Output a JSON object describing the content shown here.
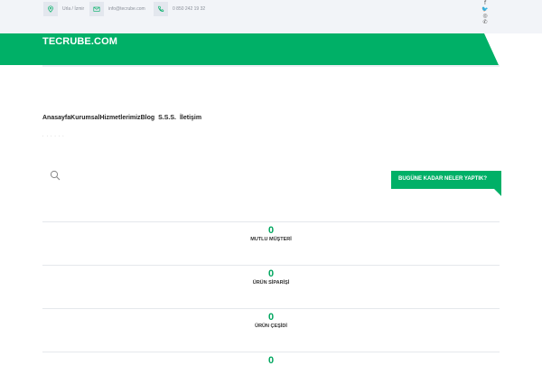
{
  "topbar": {
    "location": "Urla / İzmir",
    "email": "info@tecrube.com",
    "phone": "0 850 242 19 32",
    "social": [
      {
        "icon": "facebook-icon",
        "glyph": "f"
      },
      {
        "icon": "twitter-icon",
        "glyph": "🐦"
      },
      {
        "icon": "instagram-icon",
        "glyph": "◎"
      },
      {
        "icon": "whatsapp-icon",
        "glyph": "✆"
      }
    ]
  },
  "header": {
    "brand": "TECRUBE.COM"
  },
  "nav": {
    "items": [
      "Anasayfa",
      "Kurumsal",
      "Hizmetlerimiz",
      "Blog",
      "S.S.S.",
      "İletişim"
    ]
  },
  "breadcrumb": "· · · · · ·",
  "cta": {
    "label": "BUGÜNE KADAR NELER YAPTIK?"
  },
  "stats": [
    {
      "value": "0",
      "label": "MUTLU MÜŞTERİ"
    },
    {
      "value": "0",
      "label": "ÜRÜN SİPARİŞİ"
    },
    {
      "value": "0",
      "label": "ÜRÜN ÇEŞİDİ"
    },
    {
      "value": "0",
      "label": ""
    }
  ],
  "colors": {
    "brand_green": "#00b067",
    "stat_green": "#00a65f",
    "topbar_bg": "#f2f4f8"
  }
}
